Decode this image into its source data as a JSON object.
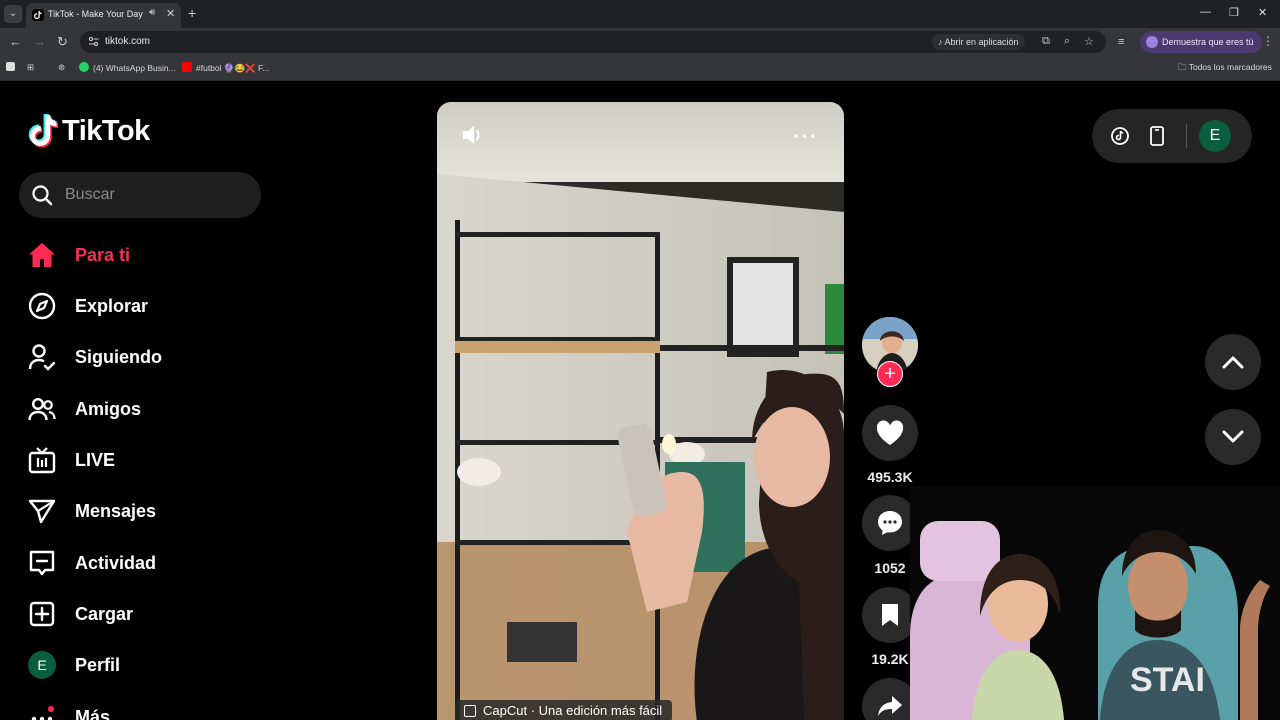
{
  "browser": {
    "tab_title": "TikTok - Make Your Day",
    "url": "tiktok.com",
    "open_in_app_label": "Abrir en aplicación",
    "profile_chip_label": "Demuestra que eres tú",
    "bookmarks": [
      {
        "label": "(4) WhatsApp Busin..."
      },
      {
        "label": "#futbol 🔮😂❌ F..."
      }
    ],
    "all_bookmarks_label": "Todos los marcadores"
  },
  "tiktok": {
    "logo_text": "TikTok",
    "search_placeholder": "Buscar",
    "nav": [
      {
        "label": "Para ti",
        "icon": "home-icon",
        "active": true
      },
      {
        "label": "Explorar",
        "icon": "compass-icon"
      },
      {
        "label": "Siguiendo",
        "icon": "following-icon"
      },
      {
        "label": "Amigos",
        "icon": "friends-icon"
      },
      {
        "label": "LIVE",
        "icon": "live-tv-icon"
      },
      {
        "label": "Mensajes",
        "icon": "paper-plane-icon"
      },
      {
        "label": "Actividad",
        "icon": "activity-icon"
      },
      {
        "label": "Cargar",
        "icon": "upload-plus-icon"
      },
      {
        "label": "Perfil",
        "icon": "profile-avatar",
        "avatar_letter": "E"
      },
      {
        "label": "Más",
        "icon": "more-dots-icon"
      }
    ],
    "video": {
      "capcut_label": "CapCut · Una edición más fácil"
    },
    "actions": {
      "likes": "495.3K",
      "comments": "1052",
      "saves": "19.2K"
    },
    "me_avatar_letter": "E",
    "colors": {
      "accent": "#fe2c55",
      "avatar_green": "#0b5e3d"
    }
  }
}
